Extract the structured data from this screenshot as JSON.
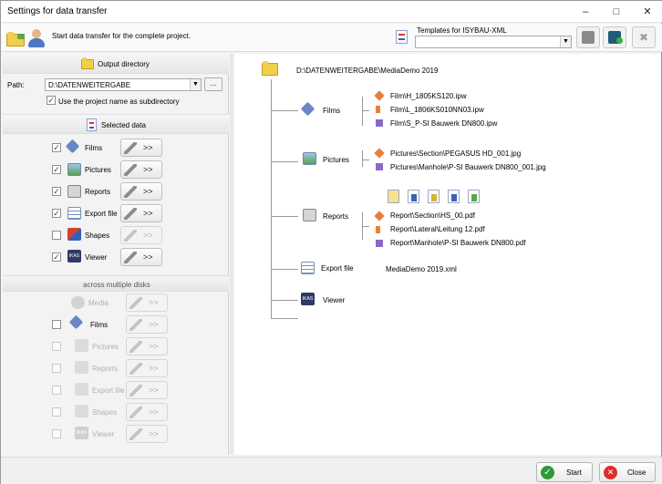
{
  "window": {
    "title": "Settings for data transfer",
    "min": "–",
    "max": "□",
    "close": "✕"
  },
  "header": {
    "text": "Start data transfer for the complete project.",
    "templates_label": "Templates for ISYBAU-XML",
    "templates_value": ""
  },
  "left": {
    "output_directory": "Output directory",
    "path_label": "Path:",
    "path_value": "D:\\DATENWEITERGABE",
    "browse": "...",
    "use_project_name": "Use the project name as subdirectory",
    "selected_data": "Selected data",
    "selected_items": [
      {
        "label": "Films",
        "checked": true,
        "enabled": true
      },
      {
        "label": "Pictures",
        "checked": true,
        "enabled": true
      },
      {
        "label": "Reports",
        "checked": true,
        "enabled": true
      },
      {
        "label": "Export file",
        "checked": true,
        "enabled": true
      },
      {
        "label": "Shapes",
        "checked": false,
        "enabled": false
      },
      {
        "label": "Viewer",
        "checked": true,
        "enabled": true
      }
    ],
    "across_disks": "across multiple disks",
    "disk_items": [
      {
        "label": "Media"
      },
      {
        "label": "Films"
      },
      {
        "label": "Pictures"
      },
      {
        "label": "Reports"
      },
      {
        "label": "Export file"
      },
      {
        "label": "Shapes"
      },
      {
        "label": "Viewer"
      }
    ],
    "arrow_label": ">>"
  },
  "right": {
    "root": "D:\\DATENWEITERGABE\\MediaDemo 2019",
    "films_label": "Films",
    "films": [
      "Film\\H_1805KS120.ipw",
      "Film\\L_1806KS010NN03.ipw",
      "Film\\S_P-SI Bauwerk DN800.ipw"
    ],
    "pictures_label": "Pictures",
    "pictures": [
      "Pictures\\Section\\PEGASUS HD_001.jpg",
      "Pictures\\Manhole\\P-SI Bauwerk DN800_001.jpg"
    ],
    "reports_label": "Reports",
    "reports": [
      "Report\\Section\\HS_00.pdf",
      "Report\\Lateral\\Leitung 12.pdf",
      "Report\\Manhole\\P-SI Bauwerk DN800.pdf"
    ],
    "export_label": "Export file",
    "export_file": "MediaDemo 2019.xml",
    "viewer_label": "Viewer"
  },
  "footer": {
    "start": "Start",
    "close": "Close"
  },
  "colors": {
    "accent_green": "#2e9a36",
    "close_red": "#d9302a",
    "folder_yellow": "#f2cf4a"
  }
}
